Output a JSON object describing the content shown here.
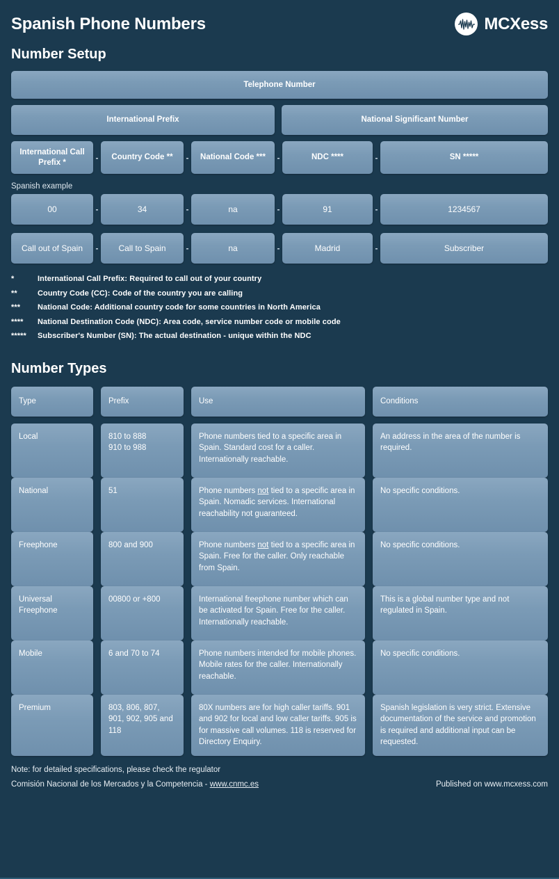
{
  "header": {
    "title": "Spanish Phone Numbers",
    "brand_name": "MCXess",
    "brand_icon": "waveform-circle-icon"
  },
  "setup": {
    "section_title": "Number Setup",
    "telephone_number": "Telephone Number",
    "international_prefix": "International Prefix",
    "national_significant_number": "National Significant Number",
    "parts": [
      "International Call Prefix *",
      "Country Code **",
      "National Code ***",
      "NDC ****",
      "SN *****"
    ],
    "separator": "-",
    "example_label": "Spanish example",
    "example_values": [
      "00",
      "34",
      "na",
      "91",
      "1234567"
    ],
    "example_descriptions": [
      "Call out of Spain",
      "Call to Spain",
      "na",
      "Madrid",
      "Subscriber"
    ]
  },
  "footnotes": [
    {
      "mark": "*",
      "text": "International Call Prefix: Required to call out of your country"
    },
    {
      "mark": "**",
      "text": "Country Code (CC): Code of the country you are calling"
    },
    {
      "mark": "***",
      "text": "National Code: Additional country code for some countries in North America"
    },
    {
      "mark": "****",
      "text": "National Destination Code (NDC): Area code, service number code or mobile code"
    },
    {
      "mark": "*****",
      "text": "Subscriber's Number (SN): The actual destination - unique within the NDC"
    }
  ],
  "types": {
    "section_title": "Number Types",
    "headers": [
      "Type",
      "Prefix",
      "Use",
      "Conditions"
    ],
    "rows": [
      {
        "type": "Local",
        "prefix": "810 to 888\n910 to 988",
        "use_pre": "Phone numbers tied to a specific area in Spain. Standard cost for a caller. Internationally reachable.",
        "use_underline": "",
        "use_post": "",
        "conditions": "An address in the area of the number is required."
      },
      {
        "type": "National",
        "prefix": "51",
        "use_pre": "Phone numbers ",
        "use_underline": "not",
        "use_post": " tied to a specific area in Spain. Nomadic services. International reachability not guaranteed.",
        "conditions": "No specific conditions."
      },
      {
        "type": "Freephone",
        "prefix": "800 and 900",
        "use_pre": "Phone numbers ",
        "use_underline": "not",
        "use_post": " tied to a specific area in Spain. Free for the caller. Only reachable from Spain.",
        "conditions": "No specific conditions."
      },
      {
        "type": "Universal Freephone",
        "prefix": "00800 or +800",
        "use_pre": "International freephone number which can be activated for Spain. Free for the caller. Internationally reachable.",
        "use_underline": "",
        "use_post": "",
        "conditions": "This is a global number type and not regulated in Spain."
      },
      {
        "type": "Mobile",
        "prefix": "6 and 70 to 74",
        "use_pre": "Phone numbers intended for mobile phones. Mobile rates for the caller. Internationally reachable.",
        "use_underline": "",
        "use_post": "",
        "conditions": "No specific conditions."
      },
      {
        "type": "Premium",
        "prefix": "803, 806, 807, 901, 902, 905 and 118",
        "use_pre": "80X numbers are for high caller tariffs. 901 and 902 for local and low caller tariffs. 905 is for massive call volumes. 118 is reserved for Directory Enquiry.",
        "use_underline": "",
        "use_post": "",
        "conditions": "Spanish legislation is very strict. Extensive documentation of the service and promotion is required and additional input can be requested."
      }
    ]
  },
  "footer": {
    "note": "Note: for detailed specifications, please check the regulator",
    "regulator_prefix": "Comisión Nacional de los Mercados y la Competencia - ",
    "regulator_link": "www.cnmc.es",
    "published": "Published on www.mcxess.com"
  },
  "colors": {
    "background": "#1b3a4f",
    "box": "#7b9bb6",
    "text": "#ffffff"
  }
}
